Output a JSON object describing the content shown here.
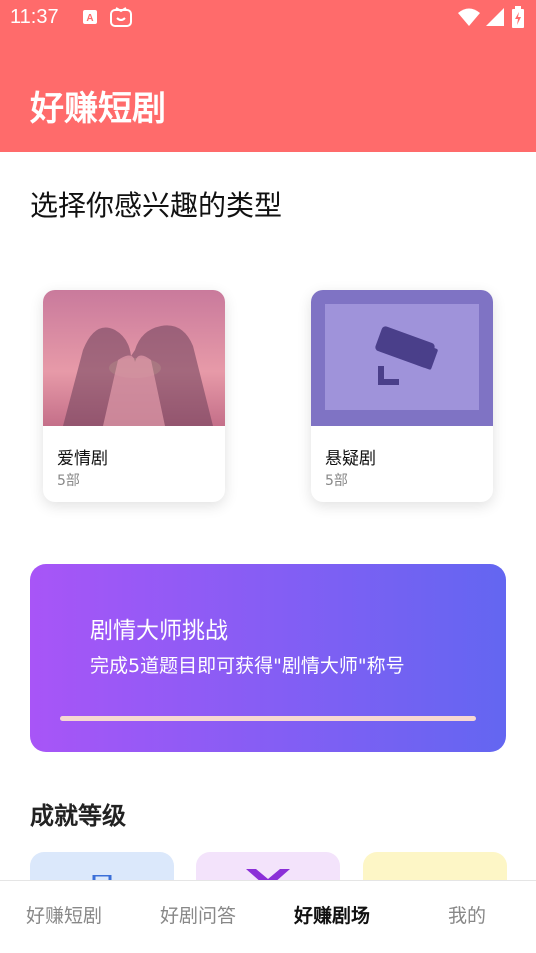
{
  "status_bar": {
    "time": "11:37",
    "icons": [
      "notification-a-icon",
      "tv-icon",
      "wifi-icon",
      "signal-icon",
      "battery-charging-icon"
    ]
  },
  "app_bar": {
    "title": "好赚短剧"
  },
  "section": {
    "title": "选择你感兴趣的类型"
  },
  "genres": [
    {
      "name": "爱情剧",
      "count": "5部",
      "image": "heart-hands-photo"
    },
    {
      "name": "悬疑剧",
      "count": "5部",
      "image": "security-camera-photo"
    }
  ],
  "challenge": {
    "title": "剧情大师挑战",
    "description": "完成5道题目即可获得\"剧情大师\"称号",
    "progress": 1.0
  },
  "achievements": {
    "title": "成就等级",
    "cards": [
      {
        "color": "#dbe8fb",
        "icon": "briefcase-icon"
      },
      {
        "color": "#f3e3fb",
        "icon": "x-badge-icon"
      },
      {
        "color": "#fdf6c6",
        "icon": "sparkle-icon"
      }
    ]
  },
  "bottom_nav": {
    "items": [
      {
        "label": "好赚短剧",
        "active": false
      },
      {
        "label": "好剧问答",
        "active": false
      },
      {
        "label": "好赚剧场",
        "active": true
      },
      {
        "label": "我的",
        "active": false
      }
    ]
  },
  "colors": {
    "primary": "#ff6b6b",
    "gradient_start": "#a855f7",
    "gradient_end": "#6366f1"
  }
}
